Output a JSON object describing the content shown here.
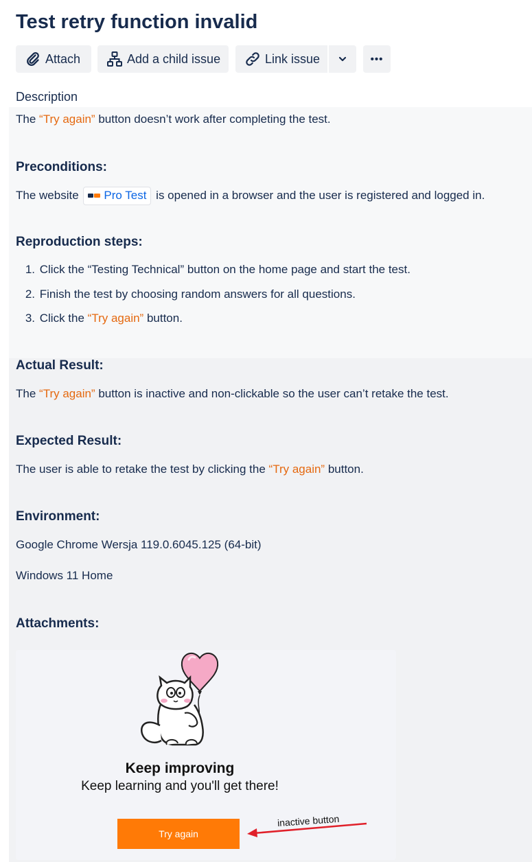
{
  "issue": {
    "title": "Test retry function invalid"
  },
  "toolbar": {
    "attach": {
      "label": "Attach",
      "icon": "paperclip-icon"
    },
    "add_child": {
      "label": "Add a child issue",
      "icon": "hierarchy-icon"
    },
    "link_issue": {
      "label": "Link issue",
      "icon": "link-icon"
    },
    "dropdown": {
      "icon": "chevron-down-icon"
    },
    "more": {
      "label": "•••",
      "icon": "more-icon"
    }
  },
  "description": {
    "label": "Description",
    "intro": {
      "before": "The ",
      "highlight": "“Try again”",
      "after": " button doesn’t work after completing the test."
    },
    "preconditions": {
      "heading": "Preconditions:",
      "before": "The website ",
      "link": "Pro Test",
      "after": " is opened in a browser and the user is registered and logged in."
    },
    "steps": {
      "heading": "Reproduction steps:",
      "items": [
        {
          "num": "1.",
          "text": "Click the “Testing Technical” button on the home page and start the test."
        },
        {
          "num": "2.",
          "text": "Finish the test by choosing random answers for all questions."
        },
        {
          "num": "3.",
          "before": "Click the ",
          "highlight": "“Try again”",
          "after": " button."
        }
      ]
    },
    "actual": {
      "heading": "Actual Result:",
      "before": "The ",
      "highlight": "“Try again”",
      "after": " button is inactive and non-clickable so the user can’t retake the test."
    },
    "expected": {
      "heading": "Expected Result:",
      "before": "The user is able to retake the test by clicking the ",
      "highlight": "“Try again”",
      "after": " button."
    },
    "environment": {
      "heading": "Environment:",
      "lines": [
        "Google Chrome Wersja 119.0.6045.125 (64-bit)",
        "Windows 11 Home"
      ]
    },
    "attachments": {
      "heading": "Attachments:",
      "screenshot": {
        "title": "Keep improving",
        "subtitle": "Keep learning and you'll get there!",
        "button": "Try again",
        "annotation": "inactive button"
      }
    }
  },
  "colors": {
    "accent_orange": "#e56910",
    "link_blue": "#0c66e4",
    "button_orange": "#ff7a06",
    "arrow_red": "#e0202a"
  }
}
